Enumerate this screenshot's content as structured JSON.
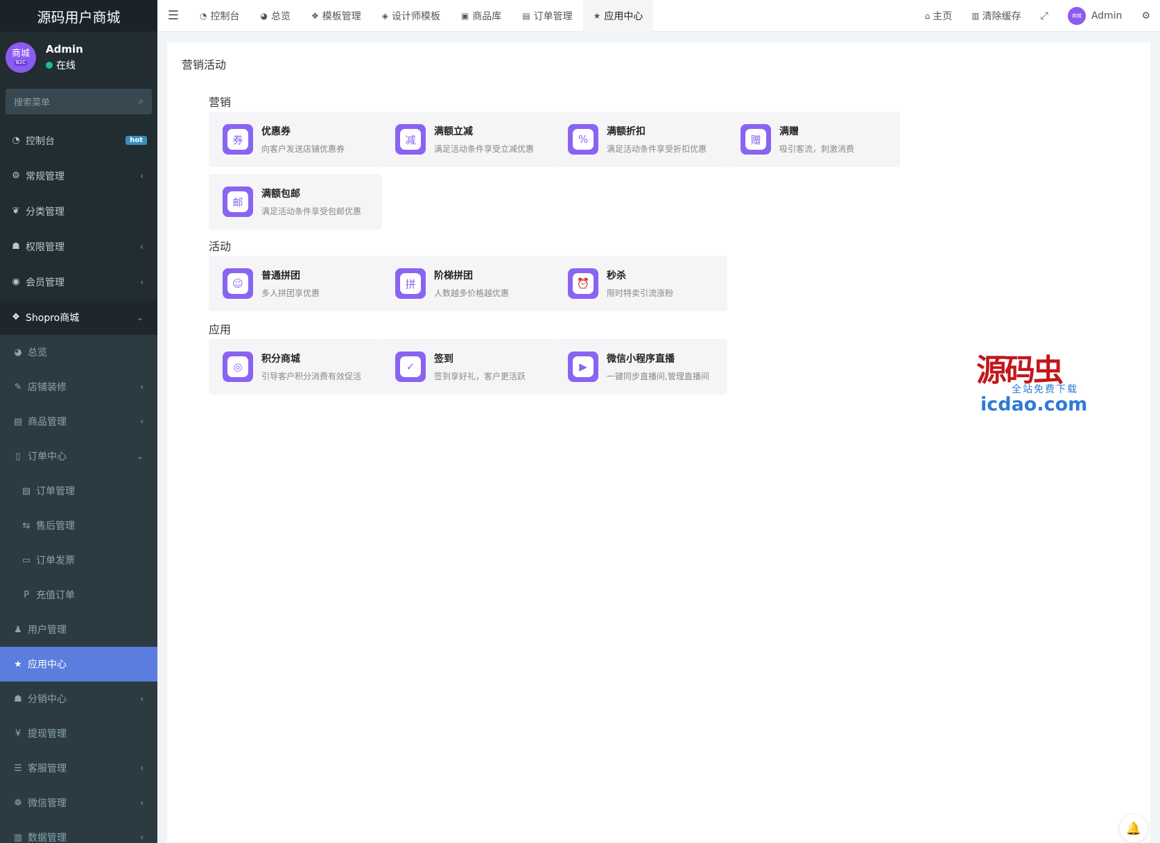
{
  "brand": {
    "title": "源码用户商城"
  },
  "user": {
    "avatar_text": "商城",
    "avatar_badge": "B2C",
    "name": "Admin",
    "status": "在线"
  },
  "search": {
    "placeholder": "搜索菜单"
  },
  "sidebar": {
    "items": [
      {
        "label": "控制台",
        "icon": "dashboard-icon",
        "glyph": "◔",
        "badge": "hot"
      },
      {
        "label": "常规管理",
        "icon": "cogs-icon",
        "glyph": "⚙",
        "arrow": "‹"
      },
      {
        "label": "分类管理",
        "icon": "leaf-icon",
        "glyph": "❦"
      },
      {
        "label": "权限管理",
        "icon": "group-icon",
        "glyph": "☗",
        "arrow": "‹"
      },
      {
        "label": "会员管理",
        "icon": "user-circle-icon",
        "glyph": "◉",
        "arrow": "‹"
      },
      {
        "label": "Shopro商城",
        "icon": "dropbox-icon",
        "glyph": "❖",
        "arrow": "⌄"
      }
    ],
    "sub_items": [
      {
        "label": "总览",
        "icon": "pie-chart-icon",
        "glyph": "◕"
      },
      {
        "label": "店铺装修",
        "icon": "brush-icon",
        "glyph": "✎",
        "arrow": "‹"
      },
      {
        "label": "商品管理",
        "icon": "archive-icon",
        "glyph": "▤",
        "arrow": "‹"
      },
      {
        "label": "订单中心",
        "icon": "file-icon",
        "glyph": "▯",
        "arrow": "⌄"
      },
      {
        "label": "订单管理",
        "icon": "file-text-icon",
        "glyph": "▤"
      },
      {
        "label": "售后管理",
        "icon": "handshake-icon",
        "glyph": "⇆"
      },
      {
        "label": "订单发票",
        "icon": "invoice-icon",
        "glyph": "▭"
      },
      {
        "label": "充值订单",
        "icon": "paypal-icon",
        "glyph": "P"
      },
      {
        "label": "用户管理",
        "icon": "user-icon",
        "glyph": "♟"
      },
      {
        "label": "应用中心",
        "icon": "star-icon",
        "glyph": "★"
      },
      {
        "label": "分销中心",
        "icon": "users-icon",
        "glyph": "☗",
        "arrow": "‹"
      },
      {
        "label": "提现管理",
        "icon": "yen-icon",
        "glyph": "¥"
      },
      {
        "label": "客服管理",
        "icon": "list-icon",
        "glyph": "☰",
        "arrow": "‹"
      },
      {
        "label": "微信管理",
        "icon": "wechat-icon",
        "glyph": "❁",
        "arrow": "‹"
      },
      {
        "label": "数据管理",
        "icon": "data-icon",
        "glyph": "▥",
        "arrow": "‹"
      }
    ]
  },
  "topbar": {
    "tabs": [
      {
        "label": "控制台",
        "icon": "dashboard-icon",
        "glyph": "◔"
      },
      {
        "label": "总览",
        "icon": "pie-chart-icon",
        "glyph": "◕"
      },
      {
        "label": "模板管理",
        "icon": "cubes-icon",
        "glyph": "❖"
      },
      {
        "label": "设计师模板",
        "icon": "cube-icon",
        "glyph": "◈"
      },
      {
        "label": "商品库",
        "icon": "shopping-bag-icon",
        "glyph": "▣"
      },
      {
        "label": "订单管理",
        "icon": "file-text-icon",
        "glyph": "▤"
      },
      {
        "label": "应用中心",
        "icon": "star-icon",
        "glyph": "★"
      }
    ],
    "home": "主页",
    "clear_cache": "清除缓存",
    "admin": "Admin",
    "admin_avatar": "商城"
  },
  "main": {
    "page_title": "营销活动",
    "sections": [
      {
        "title": "营销",
        "cards": [
          {
            "title": "优惠券",
            "desc": "向客户发送店铺优惠券",
            "glyph": "券",
            "icon": "coupon-icon"
          },
          {
            "title": "满额立减",
            "desc": "满足活动条件享受立减优惠",
            "glyph": "减",
            "icon": "discount-cut-icon"
          },
          {
            "title": "满额折扣",
            "desc": "满足活动条件享受折扣优惠",
            "glyph": "%",
            "icon": "percent-icon"
          },
          {
            "title": "满赠",
            "desc": "吸引客流，刺激消费",
            "glyph": "赠",
            "icon": "gift-icon"
          },
          {
            "title": "满额包邮",
            "desc": "满足活动条件享受包邮优惠",
            "glyph": "邮",
            "icon": "free-shipping-icon"
          }
        ]
      },
      {
        "title": "活动",
        "cards": [
          {
            "title": "普通拼团",
            "desc": "多人拼团享优惠",
            "glyph": "☺",
            "icon": "group-buy-icon"
          },
          {
            "title": "阶梯拼团",
            "desc": "人数越多价格越优惠",
            "glyph": "拼",
            "icon": "tiered-group-icon"
          },
          {
            "title": "秒杀",
            "desc": "限时特卖引流涨粉",
            "glyph": "⏰",
            "icon": "alarm-clock-icon"
          }
        ]
      },
      {
        "title": "应用",
        "cards": [
          {
            "title": "积分商城",
            "desc": "引导客户积分消费有效促活",
            "glyph": "◎",
            "icon": "points-icon"
          },
          {
            "title": "签到",
            "desc": "签到享好礼，客户更活跃",
            "glyph": "✓",
            "icon": "checkin-icon"
          },
          {
            "title": "微信小程序直播",
            "desc": "一键同步直播间,管理直播间",
            "glyph": "▶",
            "icon": "live-tv-icon"
          }
        ]
      }
    ]
  },
  "watermark": {
    "logo": "源码虫",
    "sub": "全站免费下载",
    "url": "icdao.com"
  },
  "colors": {
    "sidebar": "#222d32",
    "accent": "#8a63f2",
    "active": "#5b7de0"
  }
}
